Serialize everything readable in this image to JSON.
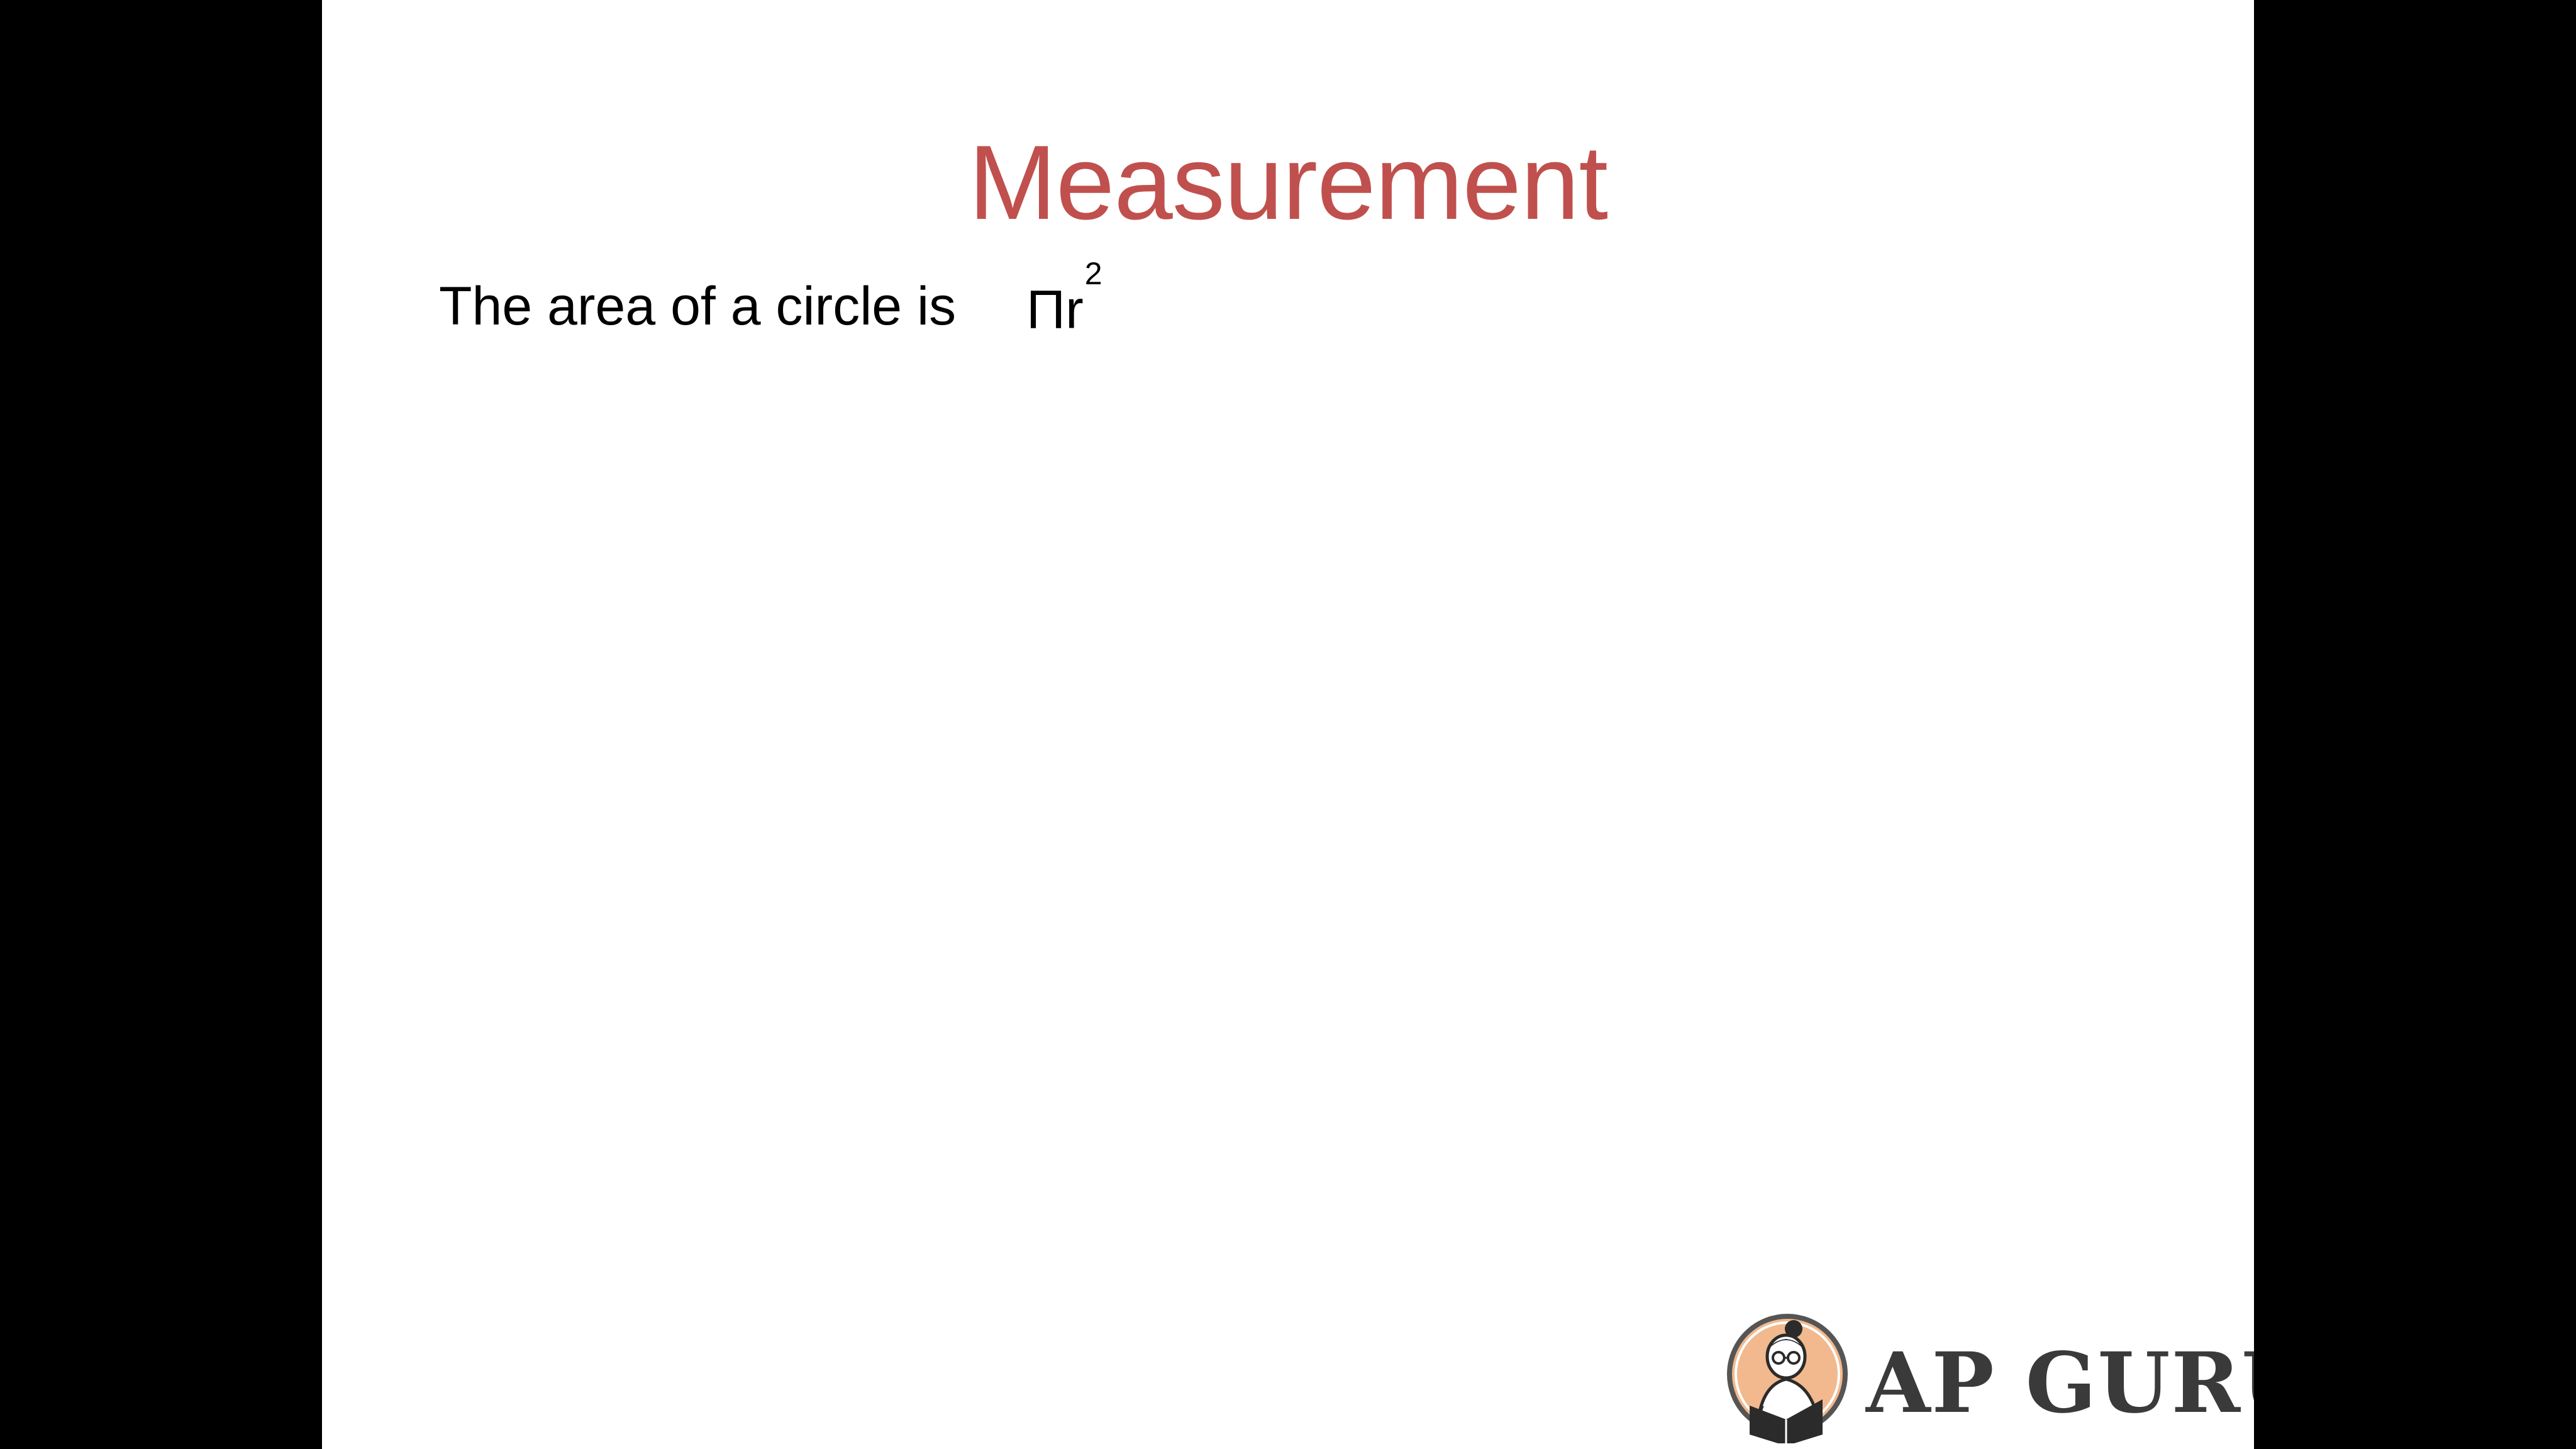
{
  "slide": {
    "title": "Measurement",
    "title_color": "#c0504d",
    "body_text": "The area of a circle is",
    "formula": {
      "symbol": "Π",
      "variable": "r",
      "exponent": "2"
    }
  },
  "logo": {
    "text": "AP GURU",
    "icon": "reading-guru-icon",
    "badge_color": "#f2b98e"
  }
}
